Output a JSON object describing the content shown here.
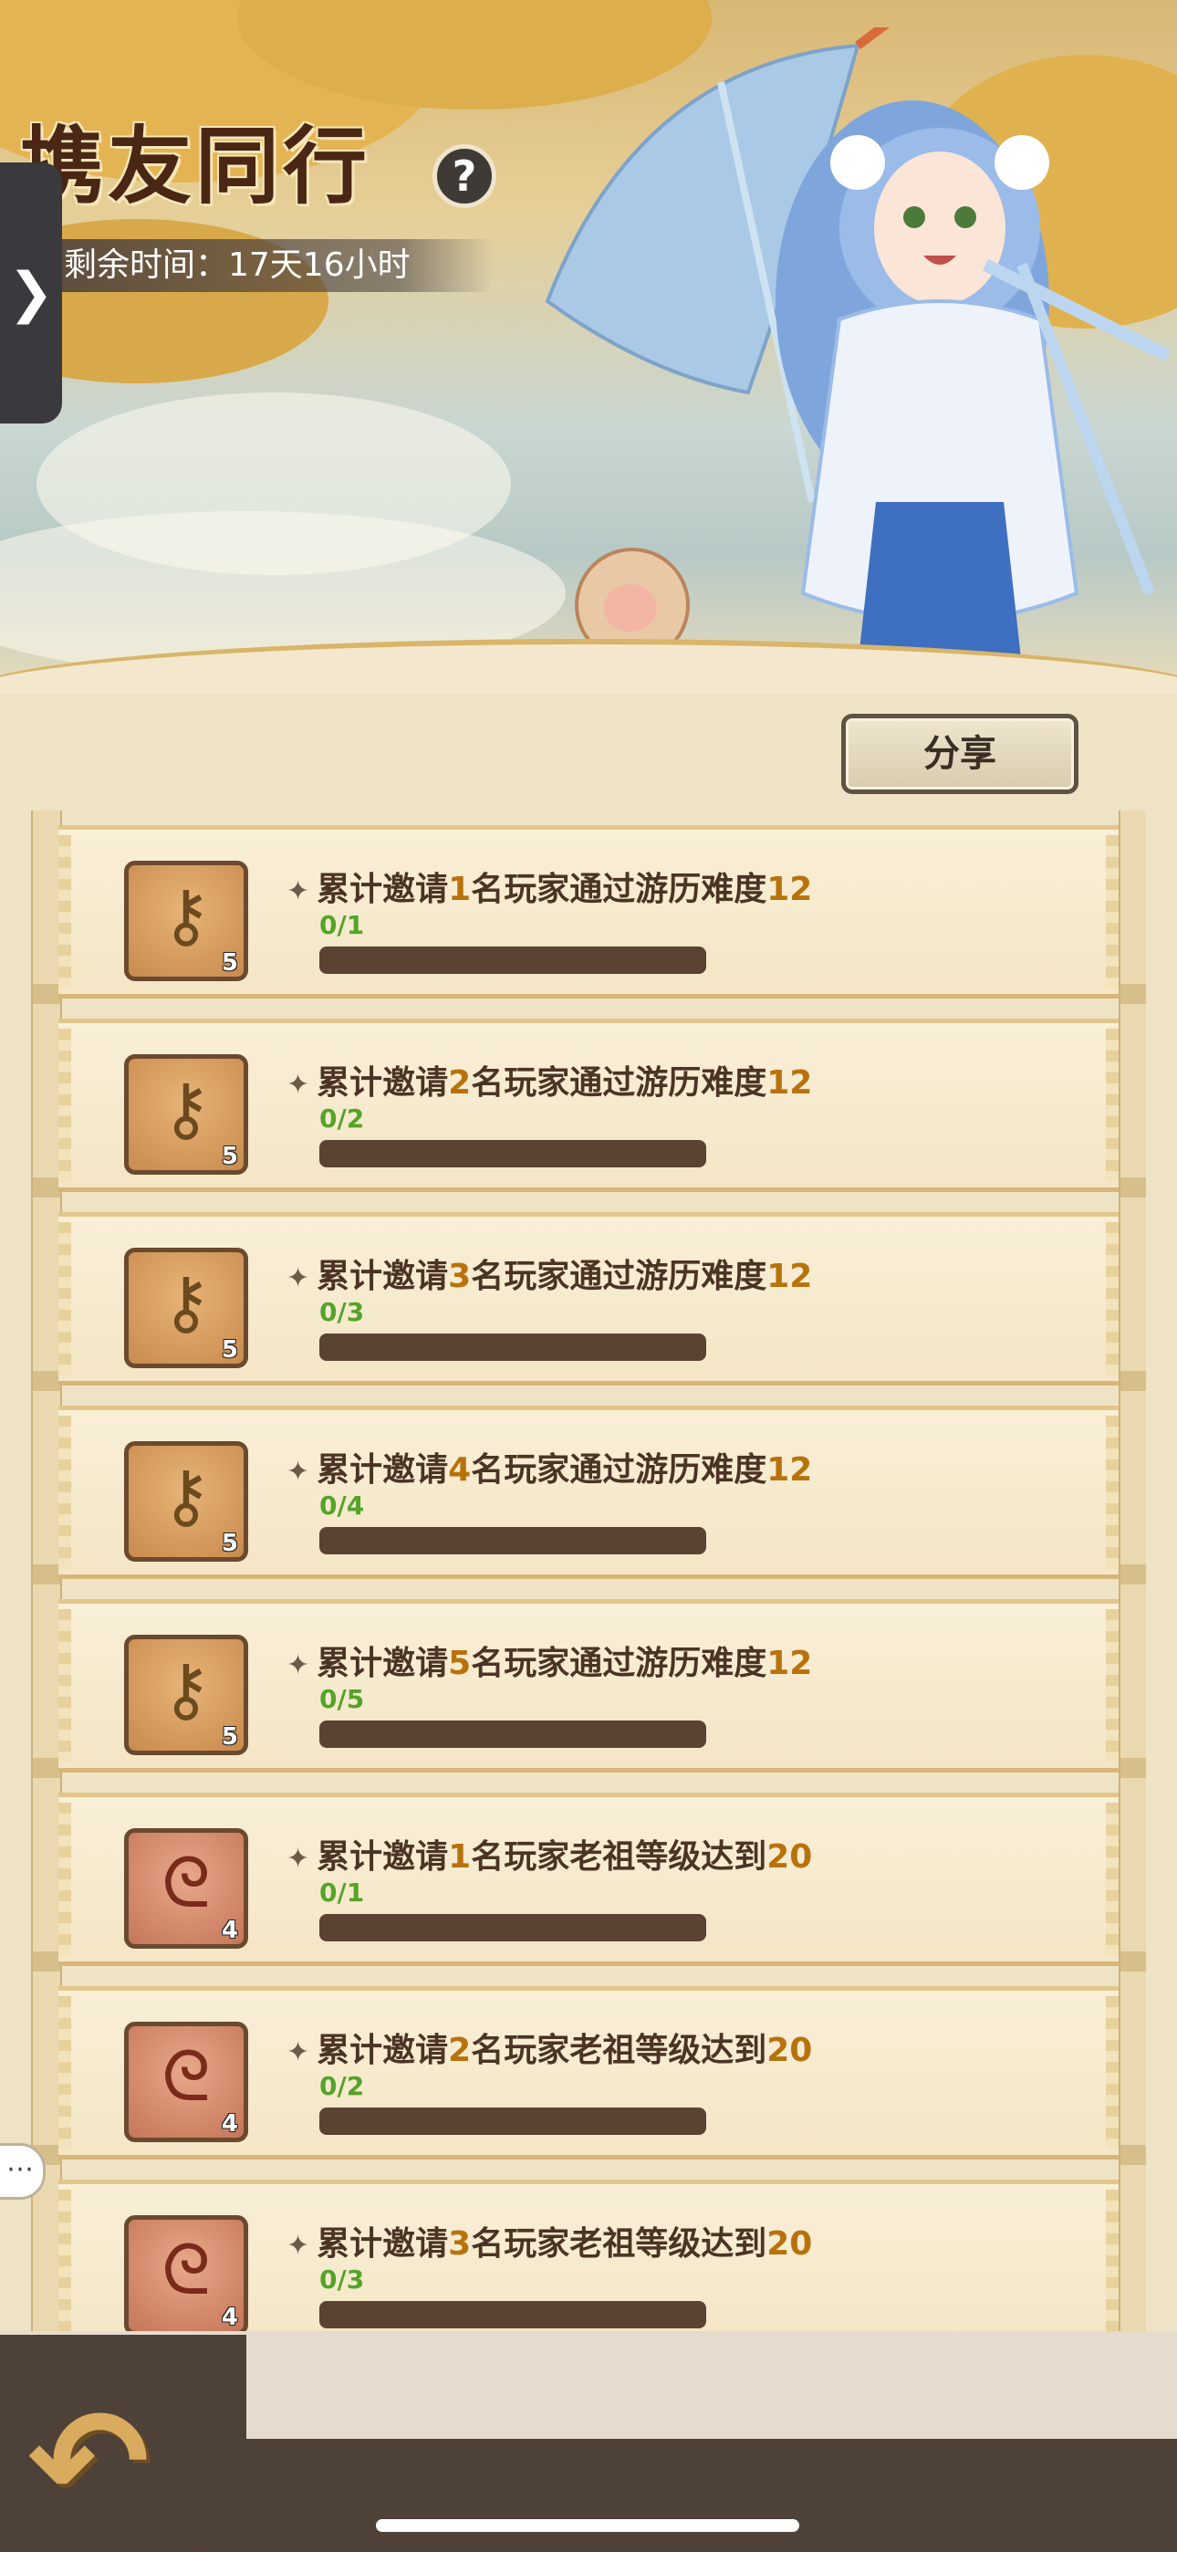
{
  "header": {
    "title": "携友同行",
    "help_label": "?",
    "timer_label": "剩余时间：17天16小时"
  },
  "side_tab_label": "❯",
  "share_label": "分享",
  "tasks": [
    {
      "pre": "累计邀请",
      "num": "1",
      "mid": "名玩家通过游历难度",
      "target": "12",
      "progress": "0/1",
      "fill": 0,
      "reward_icon": "key-icon",
      "reward_glyph": "⚷",
      "reward_count": "5"
    },
    {
      "pre": "累计邀请",
      "num": "2",
      "mid": "名玩家通过游历难度",
      "target": "12",
      "progress": "0/2",
      "fill": 0,
      "reward_icon": "key-icon",
      "reward_glyph": "⚷",
      "reward_count": "5"
    },
    {
      "pre": "累计邀请",
      "num": "3",
      "mid": "名玩家通过游历难度",
      "target": "12",
      "progress": "0/3",
      "fill": 0,
      "reward_icon": "key-icon",
      "reward_glyph": "⚷",
      "reward_count": "5"
    },
    {
      "pre": "累计邀请",
      "num": "4",
      "mid": "名玩家通过游历难度",
      "target": "12",
      "progress": "0/4",
      "fill": 0,
      "reward_icon": "key-icon",
      "reward_glyph": "⚷",
      "reward_count": "5"
    },
    {
      "pre": "累计邀请",
      "num": "5",
      "mid": "名玩家通过游历难度",
      "target": "12",
      "progress": "0/5",
      "fill": 0,
      "reward_icon": "key-icon",
      "reward_glyph": "⚷",
      "reward_count": "5"
    },
    {
      "pre": "累计邀请",
      "num": "1",
      "mid": "名玩家老祖等级达到",
      "target": "20",
      "progress": "0/1",
      "fill": 0,
      "reward_icon": "scroll-icon",
      "reward_glyph": "ᘓ",
      "reward_count": "4"
    },
    {
      "pre": "累计邀请",
      "num": "2",
      "mid": "名玩家老祖等级达到",
      "target": "20",
      "progress": "0/2",
      "fill": 0,
      "reward_icon": "scroll-icon",
      "reward_glyph": "ᘓ",
      "reward_count": "4"
    },
    {
      "pre": "累计邀请",
      "num": "3",
      "mid": "名玩家老祖等级达到",
      "target": "20",
      "progress": "0/3",
      "fill": 0,
      "reward_icon": "scroll-icon",
      "reward_glyph": "ᘓ",
      "reward_count": "4"
    }
  ],
  "chat_label": "⋯",
  "back_label": "↶",
  "colors": {
    "highlight": "#b8720c",
    "progress_text": "#55a32a",
    "bar_bg": "#5a4332",
    "title": "#4a2615"
  }
}
